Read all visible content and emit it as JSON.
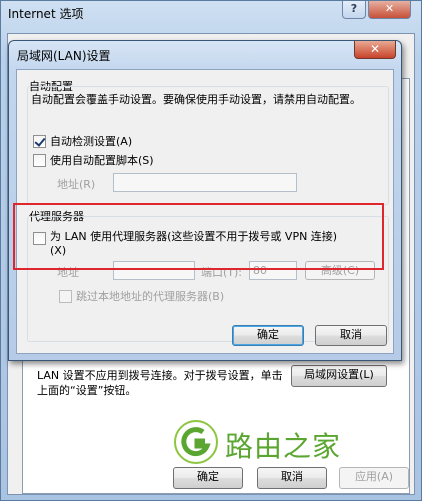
{
  "parent": {
    "title": "Internet 选项",
    "help_glyph": "?",
    "close_glyph": "✕",
    "lan_description": "LAN 设置不应用到拨号连接。对于拨号设置，单击上面的“设置”按钮。",
    "lan_settings_button": "局域网设置(L)",
    "ok_button": "确定",
    "cancel_button": "取消",
    "apply_button": "应用(A)"
  },
  "watermark": {
    "text": "路由之家",
    "color": "#5aa631"
  },
  "dialog": {
    "title": "局域网(LAN)设置",
    "close_glyph": "✕",
    "auto_config": {
      "heading": "自动配置",
      "description": "自动配置会覆盖手动设置。要确保使用手动设置，请禁用自动配置。",
      "auto_detect_label": "自动检测设置(A)",
      "auto_detect_checked": true,
      "use_script_label": "使用自动配置脚本(S)",
      "use_script_checked": false,
      "address_label": "地址(R)",
      "address_value": ""
    },
    "proxy": {
      "heading": "代理服务器",
      "use_proxy_label": "为 LAN 使用代理服务器(这些设置不用于拨号或 VPN 连接)",
      "use_proxy_hotkey": "(X)",
      "use_proxy_checked": false,
      "address_label": "地址",
      "address_value": "",
      "port_label": "端口(T):",
      "port_value": "80",
      "advanced_button": "高级(C)",
      "bypass_local_label": "跳过本地地址的代理服务器(B)",
      "bypass_local_checked": false
    },
    "ok_button": "确定",
    "cancel_button": "取消"
  },
  "colors": {
    "highlight": "#e0262d",
    "accent": "#3c7fb1"
  }
}
